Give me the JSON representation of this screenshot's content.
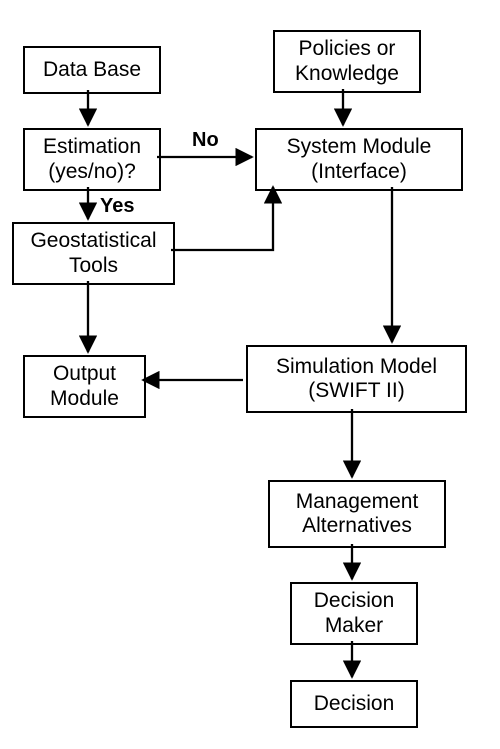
{
  "nodes": {
    "database": "Data Base",
    "estimation": "Estimation\n(yes/no)?",
    "geostat": "Geostatistical\nTools",
    "output": "Output\nModule",
    "policies": "Policies or\nKnowledge",
    "system": "System Module\n(Interface)",
    "simulation": "Simulation Model\n(SWIFT II)",
    "management": "Management\nAlternatives",
    "decision_maker": "Decision\nMaker",
    "decision": "Decision"
  },
  "labels": {
    "no": "No",
    "yes": "Yes"
  },
  "chart_data": {
    "type": "flowchart",
    "title": "",
    "nodes": [
      {
        "id": "database",
        "label": "Data Base"
      },
      {
        "id": "estimation",
        "label": "Estimation (yes/no)?",
        "kind": "decision"
      },
      {
        "id": "geostat",
        "label": "Geostatistical Tools"
      },
      {
        "id": "output",
        "label": "Output Module"
      },
      {
        "id": "policies",
        "label": "Policies or Knowledge"
      },
      {
        "id": "system",
        "label": "System Module (Interface)"
      },
      {
        "id": "simulation",
        "label": "Simulation Model (SWIFT II)"
      },
      {
        "id": "management",
        "label": "Management Alternatives"
      },
      {
        "id": "decision_maker",
        "label": "Decision Maker"
      },
      {
        "id": "decision",
        "label": "Decision"
      }
    ],
    "edges": [
      {
        "from": "database",
        "to": "estimation"
      },
      {
        "from": "estimation",
        "to": "geostat",
        "label": "Yes"
      },
      {
        "from": "estimation",
        "to": "system",
        "label": "No"
      },
      {
        "from": "geostat",
        "to": "system"
      },
      {
        "from": "geostat",
        "to": "output"
      },
      {
        "from": "policies",
        "to": "system"
      },
      {
        "from": "system",
        "to": "simulation"
      },
      {
        "from": "simulation",
        "to": "output"
      },
      {
        "from": "simulation",
        "to": "management"
      },
      {
        "from": "management",
        "to": "decision_maker"
      },
      {
        "from": "decision_maker",
        "to": "decision"
      }
    ]
  }
}
